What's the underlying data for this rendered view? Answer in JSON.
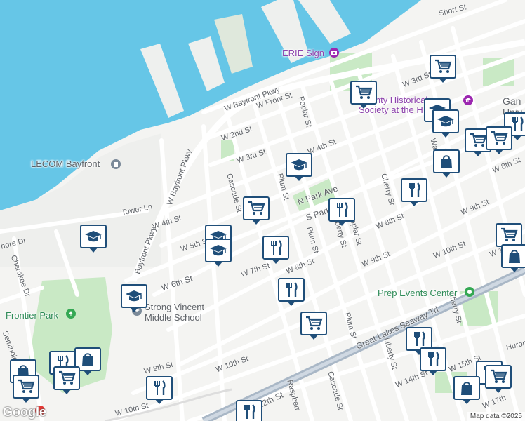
{
  "map": {
    "attribution": "Map data ©2025",
    "logo": "Google",
    "colors": {
      "water": "#66c6e7",
      "land": "#f4f4f2",
      "park": "#c9e9c5",
      "road": "#ffffff",
      "highway": "#a9b7c6",
      "marker_border": "#1f4e79"
    }
  },
  "streets": [
    {
      "id": "short-st",
      "label": "Short St"
    },
    {
      "id": "w-bayfront-pkwy-1",
      "label": "W Bayfront Pkwy"
    },
    {
      "id": "w-front-st",
      "label": "W Front St"
    },
    {
      "id": "w-2nd-st",
      "label": "W 2nd St"
    },
    {
      "id": "w-3rd-st-a",
      "label": "W 3rd St"
    },
    {
      "id": "w-3rd-st-b",
      "label": "W 3rd St"
    },
    {
      "id": "w-4th-st-a",
      "label": "W 4th St"
    },
    {
      "id": "w-4th-st-b",
      "label": "W 4th St"
    },
    {
      "id": "poplar-st-a",
      "label": "Poplar St"
    },
    {
      "id": "poplar-st-b",
      "label": "Poplar St"
    },
    {
      "id": "w-bayfront-pkwy-2",
      "label": "W Bayfront Pkwy"
    },
    {
      "id": "bayfront-pkwy",
      "label": "Bayfront Pkwy"
    },
    {
      "id": "cascade-st-a",
      "label": "Cascade St"
    },
    {
      "id": "cascade-st-b",
      "label": "Cascade St"
    },
    {
      "id": "plum-st-a",
      "label": "Plum St"
    },
    {
      "id": "plum-st-b",
      "label": "Plum St"
    },
    {
      "id": "plum-st-c",
      "label": "Plum St"
    },
    {
      "id": "n-park-ave",
      "label": "N Park Ave"
    },
    {
      "id": "s-park",
      "label": "S Park"
    },
    {
      "id": "liberty-st-a",
      "label": "Liberty St"
    },
    {
      "id": "liberty-st-b",
      "label": "Liberty St"
    },
    {
      "id": "cherry-st-a",
      "label": "Cherry St"
    },
    {
      "id": "cherry-st-b",
      "label": "Cherry St"
    },
    {
      "id": "walnut-st",
      "label": "Walnut St"
    },
    {
      "id": "w-8th-st-a",
      "label": "W 8th St"
    },
    {
      "id": "w-8th-st-b",
      "label": "W 8th St"
    },
    {
      "id": "w-8th-st-c",
      "label": "W 8th St"
    },
    {
      "id": "w-9th-st-a",
      "label": "W 9th St"
    },
    {
      "id": "w-9th-st-b",
      "label": "W 9th St"
    },
    {
      "id": "w-9th-st-c",
      "label": "W 9th St"
    },
    {
      "id": "w-10th-st-a",
      "label": "W 10th St"
    },
    {
      "id": "w-10th-st-b",
      "label": "W 10th St"
    },
    {
      "id": "w-10th-st-c",
      "label": "W 10th St"
    },
    {
      "id": "w-5th-st",
      "label": "W 5th St"
    },
    {
      "id": "w-6th-st",
      "label": "W 6th St"
    },
    {
      "id": "w-7th-st",
      "label": "W 7th St"
    },
    {
      "id": "tower-ln",
      "label": "Tower Ln"
    },
    {
      "id": "shore-dr",
      "label": "hore Dr"
    },
    {
      "id": "cherokee-dr",
      "label": "Cherokee Dr"
    },
    {
      "id": "seminole",
      "label": "Seminole"
    },
    {
      "id": "great-lakes-seaway",
      "label": "Great Lakes Seaway Trl"
    },
    {
      "id": "w-12th-st",
      "label": "W 12th St"
    },
    {
      "id": "raspberry",
      "label": "Raspberr"
    },
    {
      "id": "cascade-st-c",
      "label": "Cascade St"
    },
    {
      "id": "w-14th-st",
      "label": "W 14th St"
    },
    {
      "id": "w-15th-st",
      "label": "W 15th St"
    },
    {
      "id": "w-17th",
      "label": "W 17th"
    },
    {
      "id": "huron",
      "label": "Huron"
    },
    {
      "id": "w-11th",
      "label": "W 11th"
    }
  ],
  "places": [
    {
      "id": "erie-sign",
      "label": "ERIE Sign"
    },
    {
      "id": "county-hist",
      "label": "County Historical\nSociety at the H"
    },
    {
      "id": "lecom-bayfront",
      "label": "LECOM Bayfront"
    },
    {
      "id": "frontier-park",
      "label": "Frontier Park"
    },
    {
      "id": "strong-vincent",
      "label": "Strong Vincent\nMiddle School"
    },
    {
      "id": "prep-events",
      "label": "Prep Events Center"
    },
    {
      "id": "gannon",
      "label": "Gan\nUniv"
    }
  ],
  "markers": [
    {
      "type": "grocery",
      "icon": "shopping-cart-icon"
    },
    {
      "type": "grocery",
      "icon": "shopping-cart-icon"
    },
    {
      "type": "school",
      "icon": "graduation-cap-icon"
    },
    {
      "type": "school",
      "icon": "graduation-cap-icon"
    },
    {
      "type": "restaurant",
      "icon": "fork-knife-icon"
    },
    {
      "type": "grocery",
      "icon": "shopping-cart-icon"
    },
    {
      "type": "grocery",
      "icon": "shopping-cart-icon"
    },
    {
      "type": "shopping",
      "icon": "shopping-bag-icon"
    },
    {
      "type": "school",
      "icon": "graduation-cap-icon"
    },
    {
      "type": "restaurant",
      "icon": "fork-knife-icon"
    },
    {
      "type": "grocery",
      "icon": "shopping-cart-icon"
    },
    {
      "type": "restaurant",
      "icon": "fork-knife-icon"
    },
    {
      "type": "school",
      "icon": "graduation-cap-icon"
    },
    {
      "type": "school",
      "icon": "graduation-cap-icon"
    },
    {
      "type": "restaurant",
      "icon": "fork-knife-icon"
    },
    {
      "type": "grocery",
      "icon": "shopping-cart-icon"
    },
    {
      "type": "shopping",
      "icon": "shopping-bag-icon"
    },
    {
      "type": "school",
      "icon": "graduation-cap-icon"
    },
    {
      "type": "school",
      "icon": "graduation-cap-icon"
    },
    {
      "type": "restaurant",
      "icon": "fork-knife-icon"
    },
    {
      "type": "grocery",
      "icon": "shopping-cart-icon"
    },
    {
      "type": "restaurant",
      "icon": "fork-knife-icon"
    },
    {
      "type": "restaurant",
      "icon": "fork-knife-icon"
    },
    {
      "type": "restaurant",
      "icon": "fork-knife-icon"
    },
    {
      "type": "shopping",
      "icon": "shopping-bag-icon"
    },
    {
      "type": "grocery",
      "icon": "shopping-cart-icon"
    },
    {
      "type": "shopping",
      "icon": "shopping-bag-icon"
    },
    {
      "type": "restaurant",
      "icon": "fork-knife-icon"
    },
    {
      "type": "grocery",
      "icon": "shopping-cart-icon"
    },
    {
      "type": "shopping",
      "icon": "shopping-bag-icon"
    },
    {
      "type": "grocery",
      "icon": "shopping-cart-icon"
    },
    {
      "type": "restaurant",
      "icon": "fork-knife-icon"
    },
    {
      "type": "restaurant",
      "icon": "fork-knife-icon"
    }
  ]
}
